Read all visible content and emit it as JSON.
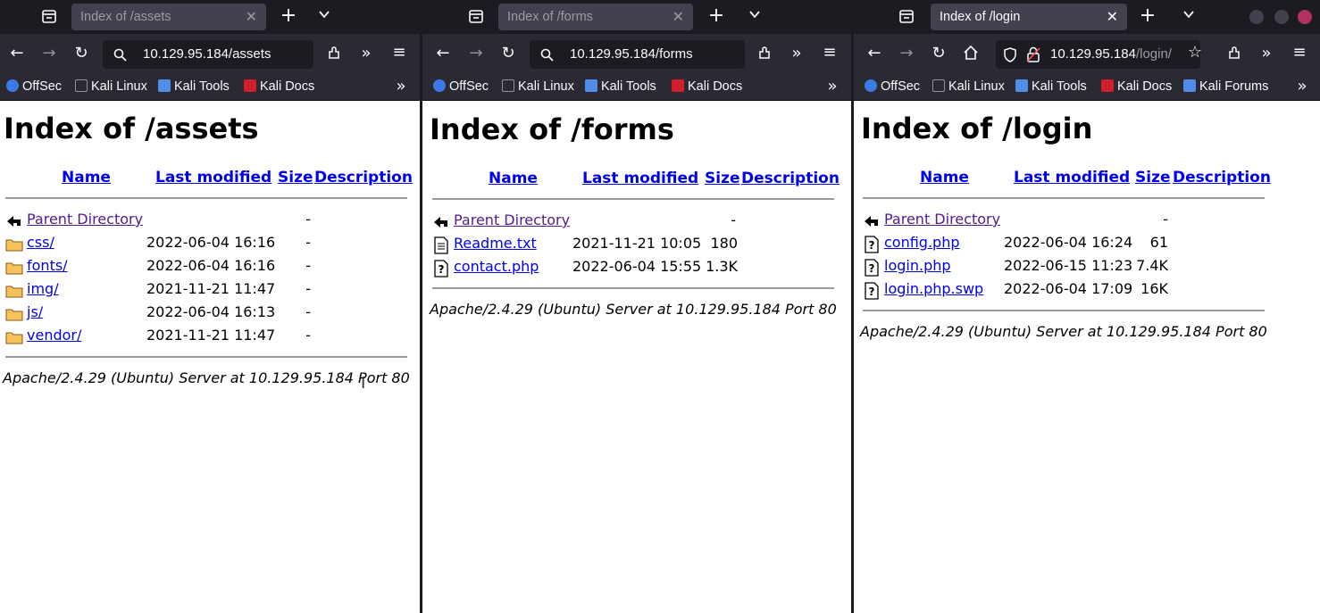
{
  "windows": [
    {
      "tab_title": "Index of /assets",
      "url": "10.129.95.184/assets",
      "bookmarks": [
        "OffSec",
        "Kali Linux",
        "Kali Tools",
        "Kali Docs"
      ],
      "heading": "Index of /assets",
      "columns": {
        "name": "Name",
        "modified": "Last modified",
        "size": "Size",
        "description": "Description"
      },
      "parent": {
        "name": "Parent Directory",
        "size": "-"
      },
      "rows": [
        {
          "name": "css/",
          "modified": "2022-06-04 16:16",
          "size": "-",
          "icon": "folder-icon"
        },
        {
          "name": "fonts/",
          "modified": "2022-06-04 16:16",
          "size": "-",
          "icon": "folder-icon"
        },
        {
          "name": "img/",
          "modified": "2021-11-21 11:47",
          "size": "-",
          "icon": "folder-icon"
        },
        {
          "name": "js/",
          "modified": "2022-06-04 16:13",
          "size": "-",
          "icon": "folder-icon"
        },
        {
          "name": "vendor/",
          "modified": "2021-11-21 11:47",
          "size": "-",
          "icon": "folder-icon"
        }
      ],
      "address": "Apache/2.4.29 (Ubuntu) Server at 10.129.95.184 Port 80"
    },
    {
      "tab_title": "Index of /forms",
      "url": "10.129.95.184/forms",
      "bookmarks": [
        "OffSec",
        "Kali Linux",
        "Kali Tools",
        "Kali Docs"
      ],
      "heading": "Index of /forms",
      "columns": {
        "name": "Name",
        "modified": "Last modified",
        "size": "Size",
        "description": "Description"
      },
      "parent": {
        "name": "Parent Directory",
        "size": "-"
      },
      "rows": [
        {
          "name": "Readme.txt",
          "modified": "2021-11-21 10:05",
          "size": "180",
          "icon": "text-file-icon"
        },
        {
          "name": "contact.php",
          "modified": "2022-06-04 15:55",
          "size": "1.3K",
          "icon": "unknown-file-icon"
        }
      ],
      "address": "Apache/2.4.29 (Ubuntu) Server at 10.129.95.184 Port 80"
    },
    {
      "tab_title": "Index of /login",
      "url_host": "10.129.95.184",
      "url_path": "/login/",
      "bookmarks": [
        "OffSec",
        "Kali Linux",
        "Kali Tools",
        "Kali Docs",
        "Kali Forums"
      ],
      "heading": "Index of /login",
      "columns": {
        "name": "Name",
        "modified": "Last modified",
        "size": "Size",
        "description": "Description"
      },
      "parent": {
        "name": "Parent Directory",
        "size": "-"
      },
      "rows": [
        {
          "name": "config.php",
          "modified": "2022-06-04 16:24",
          "size": "61",
          "icon": "unknown-file-icon"
        },
        {
          "name": "login.php",
          "modified": "2022-06-15 11:23",
          "size": "7.4K",
          "icon": "unknown-file-icon"
        },
        {
          "name": "login.php.swp",
          "modified": "2022-06-04 17:09",
          "size": "16K",
          "icon": "unknown-file-icon"
        }
      ],
      "address": "Apache/2.4.29 (Ubuntu) Server at 10.129.95.184 Port 80"
    }
  ],
  "colors": {
    "tabbar": "#1c1b22",
    "toolbar": "#2b2a33",
    "link": "#0000ee",
    "visited_link": "#551a8b"
  }
}
